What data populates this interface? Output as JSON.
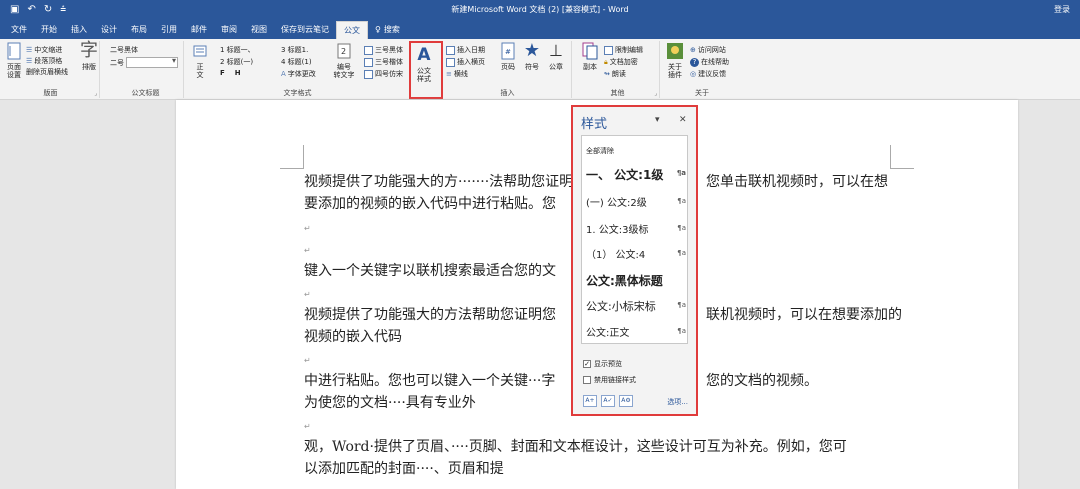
{
  "titlebar": {
    "save_icon": "save-icon",
    "undo_icon": "undo-icon",
    "redo_icon": "redo-icon",
    "title": "新建Microsoft Word 文档 (2) [兼容模式] - Word",
    "login": "登录"
  },
  "tabs": [
    "文件",
    "开始",
    "插入",
    "设计",
    "布局",
    "引用",
    "邮件",
    "审阅",
    "视图",
    "保存到云笔记",
    "公文"
  ],
  "search_tab": "搜索",
  "ribbon": {
    "layout_group": {
      "page_setup": "页面\n设置",
      "item1": "中文缩进",
      "item2": "段落顶格",
      "item3": "删除页眉横线",
      "typeset": "排版",
      "label": "版面"
    },
    "title_group": {
      "size1": "二号黑体",
      "size2": "二号",
      "label": "公文标题"
    },
    "text_group": {
      "zhengwen": "正\n文",
      "h1": "1 标题一、",
      "h2": "2 标题(一)",
      "h3": "3 标题1.",
      "h4": "4 标题(1)",
      "f": "F",
      "h": "H",
      "font_change": "字体更改",
      "numbering": "编号\n转文字",
      "font1": "三号黑体",
      "font2": "三号楷体",
      "font3": "四号仿宋",
      "label": "文字格式"
    },
    "doc_style": "公文\n样式",
    "insert_group": {
      "date": "插入日期",
      "across": "插入横页",
      "hline": "横线",
      "page_no": "页码",
      "symbol": "符号",
      "seal": "公章",
      "label": "插入"
    },
    "other_group": {
      "copy": "副本",
      "restrict": "限制编辑",
      "encrypt": "文档加密",
      "read": "朗读",
      "label": "其他"
    },
    "about_group": {
      "about": "关于\n插件",
      "visit": "访问网站",
      "help": "在线帮助",
      "feedback": "建议反馈",
      "label": "关于"
    }
  },
  "document": {
    "p1a": "视频提供了功能强大的方·······法帮助您证明",
    "p1b": "您单击联机视频时，可以在想",
    "p2": "要添加的视频的嵌入代码中进行粘贴。您",
    "p3": "键入一个关键字以联机搜索最适合您的文",
    "p4a": "视频提供了功能强大的方法帮助您证明您",
    "p4b": "联机视频时，可以在想要添加的",
    "p5": "视频的嵌入代码",
    "p6a": "中进行粘贴。您也可以键入一个关键···字",
    "p6b": "您的文档的视频。",
    "p7": "为使您的文档····具有专业外",
    "p8": "观，Word·提供了页眉、····页脚、封面和文本框设计，这些设计可互为补充。例如，您可",
    "p9": "以添加匹配的封面····、页眉和提"
  },
  "styles_pane": {
    "title": "样式",
    "clear_all": "全部清除",
    "items": [
      "一、 公文:1级",
      "(一) 公文:2级",
      "1. 公文:3级标",
      "（1） 公文:4",
      "公文:黑体标题",
      "公文:小标宋标",
      "公文:正文"
    ],
    "show_preview": "显示预览",
    "disable_linked": "禁用链接样式",
    "options": "选项..."
  }
}
